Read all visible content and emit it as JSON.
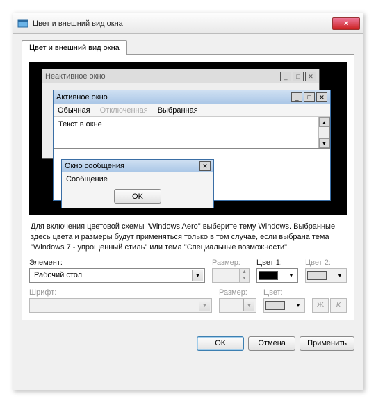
{
  "window": {
    "title": "Цвет и внешний вид окна",
    "close_icon": "×"
  },
  "tab": {
    "label": "Цвет и внешний вид окна"
  },
  "preview": {
    "inactive_title": "Неактивное окно",
    "active_title": "Активное окно",
    "menu": {
      "normal": "Обычная",
      "disabled": "Отключенная",
      "selected": "Выбранная"
    },
    "text_in_window": "Текст в окне",
    "msgbox_title": "Окно сообщения",
    "msgbox_text": "Сообщение",
    "msgbox_ok": "OK",
    "btn_min": "_",
    "btn_max": "□",
    "btn_close": "✕"
  },
  "description": "Для включения цветовой схемы \"Windows Aero\" выберите тему Windows. Выбранные здесь цвета и размеры будут применяться только в том случае, если выбрана тема \"Windows 7 - упрощенный стиль\" или тема \"Специальные возможности\".",
  "labels": {
    "element": "Элемент:",
    "size": "Размер:",
    "color1": "Цвет 1:",
    "color2": "Цвет 2:",
    "font": "Шрифт:",
    "fsize": "Размер:",
    "fcolor": "Цвет:"
  },
  "element_value": "Рабочий стол",
  "color1_value": "#000000",
  "style": {
    "bold": "Ж",
    "italic": "К"
  },
  "buttons": {
    "ok": "OK",
    "cancel": "Отмена",
    "apply": "Применить"
  },
  "glyph": {
    "down": "▼",
    "up": "▲"
  }
}
